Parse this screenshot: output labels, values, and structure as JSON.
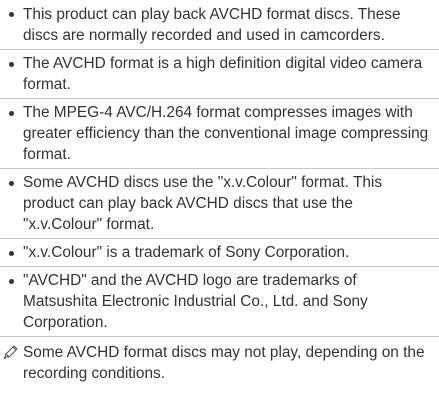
{
  "bullets": [
    {
      "text": "This product can play back AVCHD format discs. These discs are normally recorded and used in camcorders."
    },
    {
      "text": "The AVCHD format is a high definition digital video camera format."
    },
    {
      "text": "The MPEG-4 AVC/H.264 format compresses images with greater efficiency than the conventional image compressing format."
    },
    {
      "text": "Some AVCHD discs use the \"x.v.Colour\" format. This product can play back AVCHD discs that use the \"x.v.Colour\" format."
    },
    {
      "text": "\"x.v.Colour\" is a trademark of Sony Corporation."
    },
    {
      "text": "\"AVCHD\" and the AVCHD logo are trademarks of Matsushita Electronic Industrial Co., Ltd. and Sony Corporation."
    }
  ],
  "note": {
    "icon": "pencil-note-icon",
    "text": "Some AVCHD format discs may not play, depending on the recording conditions."
  }
}
